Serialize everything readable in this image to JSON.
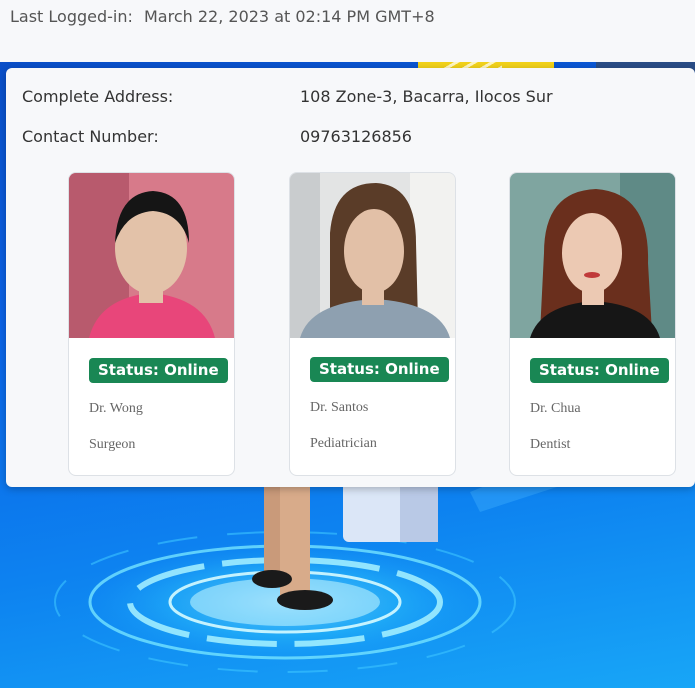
{
  "header": {
    "last_login_label": "Last Logged-in:",
    "last_login_value": "March 22, 2023 at 02:14 PM GMT+8"
  },
  "profile": {
    "address_label": "Complete Address:",
    "address_value": "108 Zone-3, Bacarra, Ilocos Sur",
    "contact_label": "Contact Number:",
    "contact_value": "09763126856"
  },
  "doctors": [
    {
      "status": "Status: Online",
      "name": "Dr. Wong",
      "specialty": "Surgeon"
    },
    {
      "status": "Status: Online",
      "name": "Dr. Santos",
      "specialty": "Pediatrician"
    },
    {
      "status": "Status: Online",
      "name": "Dr. Chua",
      "specialty": "Dentist"
    }
  ],
  "colors": {
    "status_online": "#198754",
    "hero_blue": "#0b63e6"
  }
}
